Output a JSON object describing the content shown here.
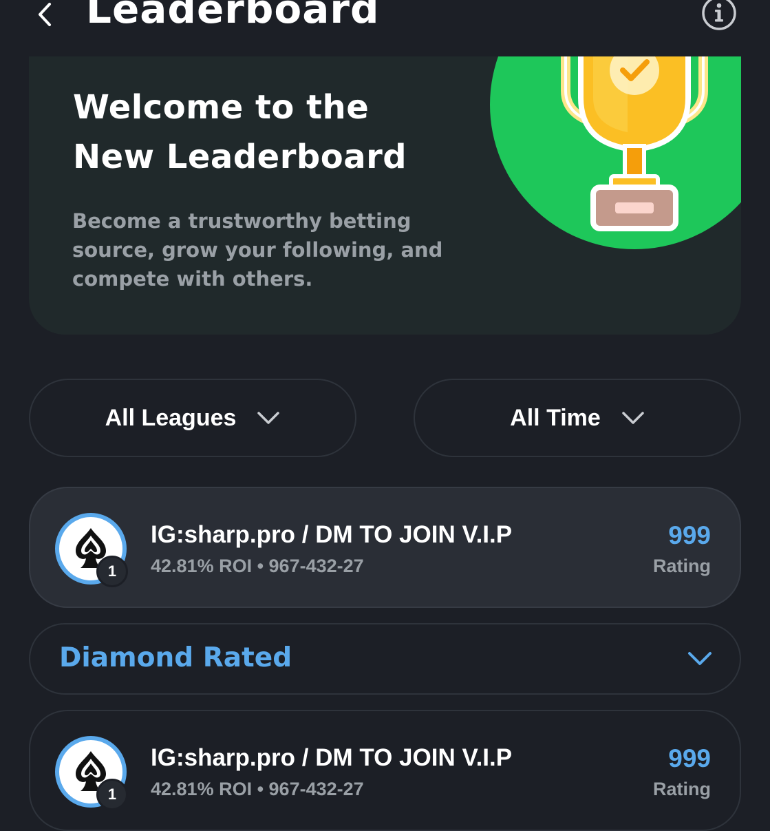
{
  "header": {
    "title": "Leaderboard",
    "back_icon": "chevron-left-icon",
    "info_icon": "info-icon"
  },
  "banner": {
    "title": "Welcome to the New Leaderboard",
    "description": "Become a trustworthy betting source, grow your following, and compete with others.",
    "illustration": "trophy-icon"
  },
  "filters": {
    "league": {
      "label": "All Leagues",
      "icon": "chevron-down-icon"
    },
    "time": {
      "label": "All Time",
      "icon": "chevron-down-icon"
    }
  },
  "top_entry": {
    "rank": "1",
    "name": "IG:sharp.pro / DM TO JOIN V.I.P",
    "stats": "42.81% ROI • 967-432-27",
    "rating": "999",
    "rating_label": "Rating",
    "avatar_icon": "spade-icon"
  },
  "section": {
    "title": "Diamond Rated",
    "icon": "chevron-down-icon"
  },
  "entries": [
    {
      "rank": "1",
      "name": "IG:sharp.pro / DM TO JOIN V.I.P",
      "stats": "42.81% ROI • 967-432-27",
      "rating": "999",
      "rating_label": "Rating",
      "avatar_icon": "spade-icon"
    }
  ],
  "colors": {
    "background": "#1c1f26",
    "banner": "#20292b",
    "accent_blue": "#5aa9ec",
    "brand_green": "#1ec75a",
    "muted_text": "#9aa0a6"
  }
}
